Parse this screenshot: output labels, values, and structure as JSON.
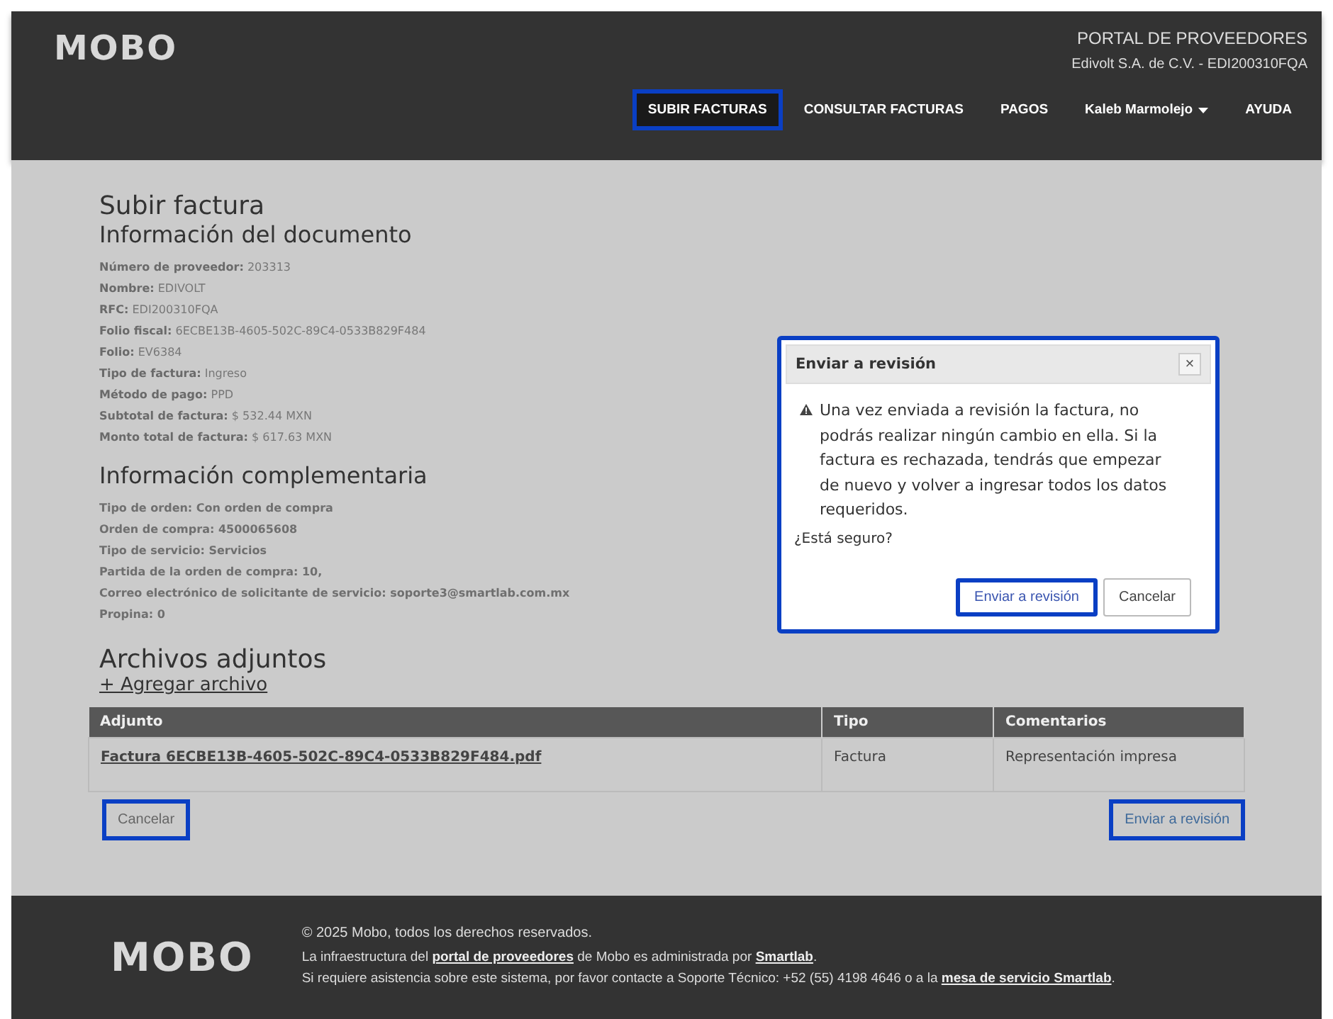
{
  "header": {
    "logo": "MOBO",
    "portal": "PORTAL DE PROVEEDORES",
    "company": "Edivolt S.A. de C.V. - EDI200310FQA",
    "nav": [
      {
        "label": "SUBIR FACTURAS",
        "selected": true,
        "highlighted": true,
        "dropdown": false
      },
      {
        "label": "CONSULTAR FACTURAS",
        "selected": false,
        "highlighted": false,
        "dropdown": false
      },
      {
        "label": "PAGOS",
        "selected": false,
        "highlighted": false,
        "dropdown": false
      },
      {
        "label": "Kaleb Marmolejo",
        "selected": false,
        "highlighted": false,
        "dropdown": true
      },
      {
        "label": "AYUDA",
        "selected": false,
        "highlighted": false,
        "dropdown": false
      }
    ]
  },
  "page_title": "Subir factura",
  "document_section": {
    "title": "Información del documento",
    "fields": [
      {
        "label": "Número de proveedor:",
        "value": "203313"
      },
      {
        "label": "Nombre:",
        "value": "EDIVOLT"
      },
      {
        "label": "RFC:",
        "value": "EDI200310FQA"
      },
      {
        "label": "Folio fiscal:",
        "value": "6ECBE13B-4605-502C-89C4-0533B829F484"
      },
      {
        "label": "Folio:",
        "value": "EV6384"
      },
      {
        "label": "Tipo de factura:",
        "value": "Ingreso"
      },
      {
        "label": "Método de pago:",
        "value": "PPD"
      },
      {
        "label": "Subtotal de factura:",
        "value": "$ 532.44 MXN"
      },
      {
        "label": "Monto total de factura:",
        "value": "$ 617.63 MXN"
      }
    ]
  },
  "complementary_section": {
    "title": "Información complementaria",
    "fields": [
      "Tipo de orden: Con orden de compra",
      "Orden de compra: 4500065608",
      "Tipo de servicio:  Servicios",
      "Partida de la orden de compra:  10,",
      "Correo electrónico de solicitante de servicio:  soporte3@smartlab.com.mx",
      "Propina: 0"
    ]
  },
  "attachments": {
    "title": "Archivos adjuntos",
    "add_link": "+ Agregar archivo",
    "columns": [
      "Adjunto",
      "Tipo",
      "Comentarios"
    ],
    "rows": [
      {
        "file": "Factura 6ECBE13B-4605-502C-89C4-0533B829F484.pdf",
        "type": "Factura",
        "comment": "Representación impresa"
      }
    ]
  },
  "actions": [
    {
      "label": "Cancelar",
      "highlighted": true
    },
    {
      "label": "Enviar a revisión",
      "highlighted": true
    }
  ],
  "dialog": {
    "title": "Enviar a revisión",
    "close": "×",
    "warning": "Una vez enviada a revisión la factura, no podrás realizar ningún cambio en ella. Si la factura es rechazada, tendrás que empezar de nuevo y volver a ingresar todos los datos requeridos.",
    "question": "¿Está seguro?",
    "highlighted": true,
    "buttons": [
      {
        "label": "Enviar a revisión",
        "primary": true,
        "highlighted": true
      },
      {
        "label": "Cancelar",
        "primary": false,
        "highlighted": false
      }
    ]
  },
  "footer": {
    "logo": "MOBO",
    "copyright": "© 2025 Mobo, todos los derechos reservados.",
    "lines": [
      [
        {
          "text": "La infraestructura del "
        },
        {
          "text": "portal de proveedores",
          "link": true
        },
        {
          "text": " de Mobo es administrada por "
        },
        {
          "text": "Smartlab",
          "link": true
        },
        {
          "text": "."
        }
      ],
      [
        {
          "text": "Si requiere asistencia sobre este sistema, por favor contacte a Soporte Técnico: +52 (55) 4198 4646 o a la "
        },
        {
          "text": "mesa de servicio Smartlab",
          "link": true
        },
        {
          "text": "."
        }
      ]
    ]
  }
}
